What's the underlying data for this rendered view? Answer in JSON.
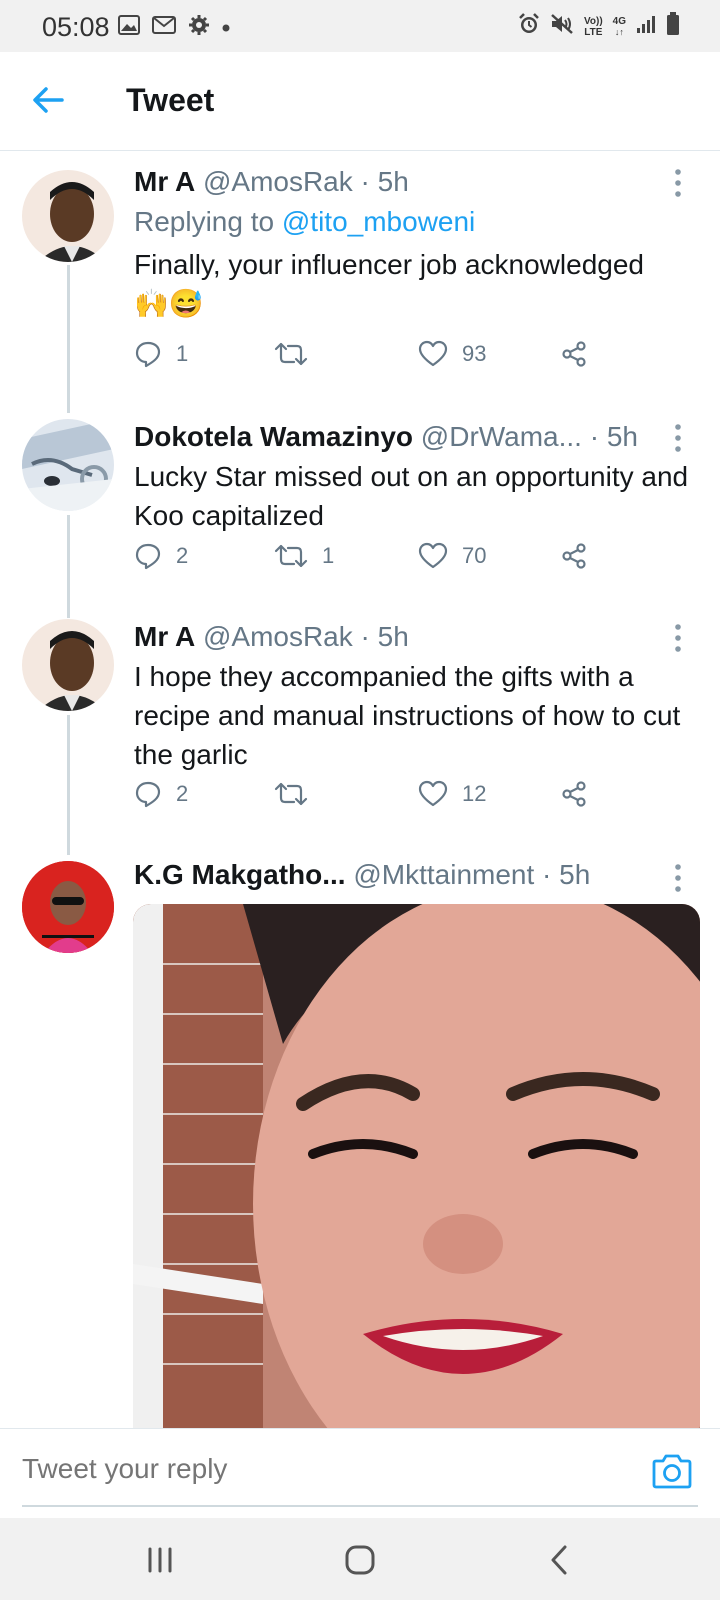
{
  "status_bar": {
    "time": "05:08",
    "left_icons": [
      "image-icon",
      "gmail-icon",
      "settings-icon",
      "dot-icon"
    ],
    "right_icons": [
      "alarm-icon",
      "mute-icon",
      "volte-icon",
      "network-4g-icon",
      "signal-icon",
      "battery-icon"
    ],
    "volte_text_top": "Vo))",
    "volte_text_bottom": "LTE",
    "net_text": "4G"
  },
  "header": {
    "back_icon": "arrow-left-icon",
    "title": "Tweet"
  },
  "accent_color": "#1da1f2",
  "tweets": [
    {
      "display_name": "Mr A",
      "handle": "@AmosRak",
      "time": " · 5h",
      "replying_prefix": "Replying to ",
      "replying_to": "@tito_mboweni",
      "text": "Finally, your influencer job acknowledged",
      "emoji": "🙌😅",
      "replies": "1",
      "retweets": "",
      "likes": "93"
    },
    {
      "display_name": "Dokotela Wamazinyo",
      "handle": "@DrWama...",
      "time": " · 5h",
      "text": "Lucky Star missed out on an opportunity and Koo capitalized",
      "replies": "2",
      "retweets": "1",
      "likes": "70"
    },
    {
      "display_name": "Mr A",
      "handle": "@AmosRak",
      "time": " · 5h",
      "text": "I hope they accompanied the gifts with a recipe and manual instructions of how to cut the garlic",
      "replies": "2",
      "retweets": "",
      "likes": "12"
    },
    {
      "display_name": "K.G Makgatho...",
      "handle": "@Mkttainment",
      "time": " · 5h",
      "media": "photo"
    }
  ],
  "reply_bar": {
    "placeholder": "Tweet your reply",
    "camera_icon": "camera-icon"
  },
  "nav_bar": {
    "icons": [
      "recents-icon",
      "home-icon",
      "back-icon"
    ]
  }
}
